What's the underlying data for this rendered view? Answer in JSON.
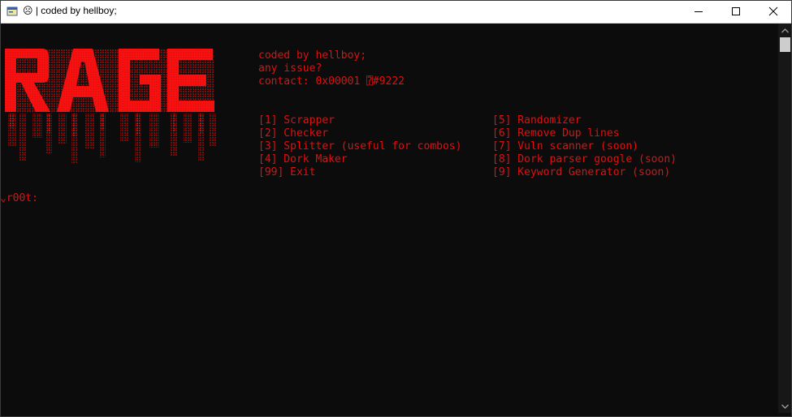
{
  "window": {
    "title": "☹ | coded by hellboy;",
    "icons": [
      "app-icon",
      "minimize-icon",
      "maximize-icon",
      "close-icon"
    ]
  },
  "console": {
    "text_color": "#e01010",
    "background": "#0c0c0c",
    "logo_text": "RAGE",
    "info": {
      "line1": "coded by hellboy;",
      "line2": "any issue?",
      "line3": "contact: 0x00001 ⍰#9222"
    },
    "menu_left": [
      "[1] Scrapper",
      "[2] Checker",
      "[3] Splitter (useful for combos)",
      "[4] Dork Maker",
      "[99] Exit"
    ],
    "menu_right": [
      "[5] Randomizer",
      "[6] Remove Dup lines",
      "[7] Vuln scanner (soon)",
      "[8] Dork parser google (soon)",
      "[9] Keyword Generator (soon)"
    ],
    "prompt": "⌄r00t:"
  }
}
